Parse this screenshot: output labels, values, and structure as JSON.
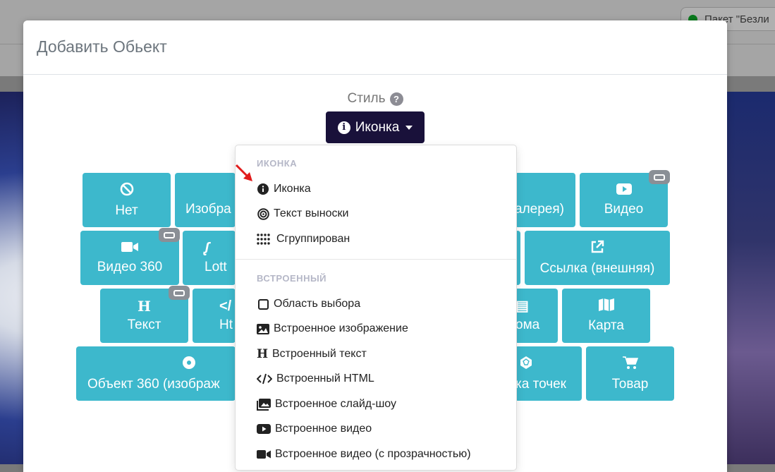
{
  "background": {
    "package_label": "Пакет \"Безли"
  },
  "modal": {
    "title": "Добавить Обьект",
    "style_label": "Стиль",
    "help_glyph": "?",
    "style_button_label": "Иконка"
  },
  "tiles": [
    {
      "label": "Нет",
      "icon": "ban-icon"
    },
    {
      "label": "Изобра",
      "icon": "image-icon"
    },
    {
      "label": "алерея)",
      "icon": "gallery-icon"
    },
    {
      "label": "Видео",
      "icon": "youtube-icon"
    },
    {
      "label": "Видео 360",
      "icon": "video-camera-icon"
    },
    {
      "label": "Lott",
      "icon": "lottie-icon"
    },
    {
      "label": "Ссылка (внешняя)",
      "icon": "external-link-icon"
    },
    {
      "label": "Текст",
      "icon": "heading-icon"
    },
    {
      "label": "Ht",
      "icon": "code-icon"
    },
    {
      "label": "ома",
      "icon": "document-icon"
    },
    {
      "label": "Карта",
      "icon": "map-icon"
    },
    {
      "label": "Объект 360 (изображ",
      "icon": "disc-icon"
    },
    {
      "label": "ка точек",
      "icon": "point-cloud-icon"
    },
    {
      "label": "Товар",
      "icon": "cart-icon"
    }
  ],
  "dropdown": {
    "section1_header": "ИКОНКА",
    "section1_items": [
      {
        "label": "Иконка",
        "icon": "info-circle-icon"
      },
      {
        "label": "Текст выноски",
        "icon": "bullseye-icon"
      },
      {
        "label": "Сгруппирован",
        "icon": "grid-dots-icon"
      }
    ],
    "section2_header": "ВСТРОЕННЫЙ",
    "section2_items": [
      {
        "label": "Область выбора",
        "icon": "square-outline-icon"
      },
      {
        "label": "Встроенное изображение",
        "icon": "image-icon"
      },
      {
        "label": "Встроенный текст",
        "icon": "heading-icon"
      },
      {
        "label": "Встроенный HTML",
        "icon": "code-icon"
      },
      {
        "label": "Встроенное слайд-шоу",
        "icon": "images-icon"
      },
      {
        "label": "Встроенное видео",
        "icon": "youtube-icon"
      },
      {
        "label": "Встроенное видео (с прозрачностью)",
        "icon": "video-camera-icon"
      }
    ]
  },
  "colors": {
    "tile": "#3db8cc",
    "style_button": "#19113a",
    "arrow": "#e11b1b"
  }
}
